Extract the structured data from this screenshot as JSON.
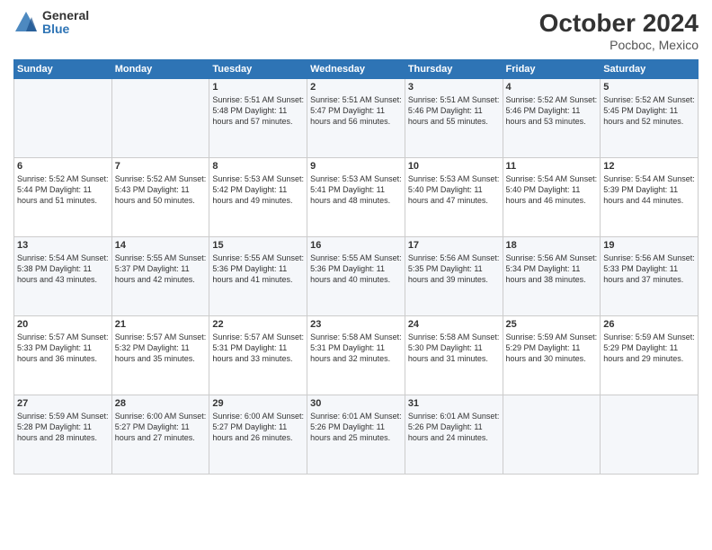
{
  "header": {
    "title": "October 2024",
    "location": "Pocboc, Mexico",
    "logo_general": "General",
    "logo_blue": "Blue"
  },
  "days_of_week": [
    "Sunday",
    "Monday",
    "Tuesday",
    "Wednesday",
    "Thursday",
    "Friday",
    "Saturday"
  ],
  "weeks": [
    [
      {
        "day": "",
        "info": ""
      },
      {
        "day": "",
        "info": ""
      },
      {
        "day": "1",
        "info": "Sunrise: 5:51 AM\nSunset: 5:48 PM\nDaylight: 11 hours and 57 minutes."
      },
      {
        "day": "2",
        "info": "Sunrise: 5:51 AM\nSunset: 5:47 PM\nDaylight: 11 hours and 56 minutes."
      },
      {
        "day": "3",
        "info": "Sunrise: 5:51 AM\nSunset: 5:46 PM\nDaylight: 11 hours and 55 minutes."
      },
      {
        "day": "4",
        "info": "Sunrise: 5:52 AM\nSunset: 5:46 PM\nDaylight: 11 hours and 53 minutes."
      },
      {
        "day": "5",
        "info": "Sunrise: 5:52 AM\nSunset: 5:45 PM\nDaylight: 11 hours and 52 minutes."
      }
    ],
    [
      {
        "day": "6",
        "info": "Sunrise: 5:52 AM\nSunset: 5:44 PM\nDaylight: 11 hours and 51 minutes."
      },
      {
        "day": "7",
        "info": "Sunrise: 5:52 AM\nSunset: 5:43 PM\nDaylight: 11 hours and 50 minutes."
      },
      {
        "day": "8",
        "info": "Sunrise: 5:53 AM\nSunset: 5:42 PM\nDaylight: 11 hours and 49 minutes."
      },
      {
        "day": "9",
        "info": "Sunrise: 5:53 AM\nSunset: 5:41 PM\nDaylight: 11 hours and 48 minutes."
      },
      {
        "day": "10",
        "info": "Sunrise: 5:53 AM\nSunset: 5:40 PM\nDaylight: 11 hours and 47 minutes."
      },
      {
        "day": "11",
        "info": "Sunrise: 5:54 AM\nSunset: 5:40 PM\nDaylight: 11 hours and 46 minutes."
      },
      {
        "day": "12",
        "info": "Sunrise: 5:54 AM\nSunset: 5:39 PM\nDaylight: 11 hours and 44 minutes."
      }
    ],
    [
      {
        "day": "13",
        "info": "Sunrise: 5:54 AM\nSunset: 5:38 PM\nDaylight: 11 hours and 43 minutes."
      },
      {
        "day": "14",
        "info": "Sunrise: 5:55 AM\nSunset: 5:37 PM\nDaylight: 11 hours and 42 minutes."
      },
      {
        "day": "15",
        "info": "Sunrise: 5:55 AM\nSunset: 5:36 PM\nDaylight: 11 hours and 41 minutes."
      },
      {
        "day": "16",
        "info": "Sunrise: 5:55 AM\nSunset: 5:36 PM\nDaylight: 11 hours and 40 minutes."
      },
      {
        "day": "17",
        "info": "Sunrise: 5:56 AM\nSunset: 5:35 PM\nDaylight: 11 hours and 39 minutes."
      },
      {
        "day": "18",
        "info": "Sunrise: 5:56 AM\nSunset: 5:34 PM\nDaylight: 11 hours and 38 minutes."
      },
      {
        "day": "19",
        "info": "Sunrise: 5:56 AM\nSunset: 5:33 PM\nDaylight: 11 hours and 37 minutes."
      }
    ],
    [
      {
        "day": "20",
        "info": "Sunrise: 5:57 AM\nSunset: 5:33 PM\nDaylight: 11 hours and 36 minutes."
      },
      {
        "day": "21",
        "info": "Sunrise: 5:57 AM\nSunset: 5:32 PM\nDaylight: 11 hours and 35 minutes."
      },
      {
        "day": "22",
        "info": "Sunrise: 5:57 AM\nSunset: 5:31 PM\nDaylight: 11 hours and 33 minutes."
      },
      {
        "day": "23",
        "info": "Sunrise: 5:58 AM\nSunset: 5:31 PM\nDaylight: 11 hours and 32 minutes."
      },
      {
        "day": "24",
        "info": "Sunrise: 5:58 AM\nSunset: 5:30 PM\nDaylight: 11 hours and 31 minutes."
      },
      {
        "day": "25",
        "info": "Sunrise: 5:59 AM\nSunset: 5:29 PM\nDaylight: 11 hours and 30 minutes."
      },
      {
        "day": "26",
        "info": "Sunrise: 5:59 AM\nSunset: 5:29 PM\nDaylight: 11 hours and 29 minutes."
      }
    ],
    [
      {
        "day": "27",
        "info": "Sunrise: 5:59 AM\nSunset: 5:28 PM\nDaylight: 11 hours and 28 minutes."
      },
      {
        "day": "28",
        "info": "Sunrise: 6:00 AM\nSunset: 5:27 PM\nDaylight: 11 hours and 27 minutes."
      },
      {
        "day": "29",
        "info": "Sunrise: 6:00 AM\nSunset: 5:27 PM\nDaylight: 11 hours and 26 minutes."
      },
      {
        "day": "30",
        "info": "Sunrise: 6:01 AM\nSunset: 5:26 PM\nDaylight: 11 hours and 25 minutes."
      },
      {
        "day": "31",
        "info": "Sunrise: 6:01 AM\nSunset: 5:26 PM\nDaylight: 11 hours and 24 minutes."
      },
      {
        "day": "",
        "info": ""
      },
      {
        "day": "",
        "info": ""
      }
    ]
  ]
}
